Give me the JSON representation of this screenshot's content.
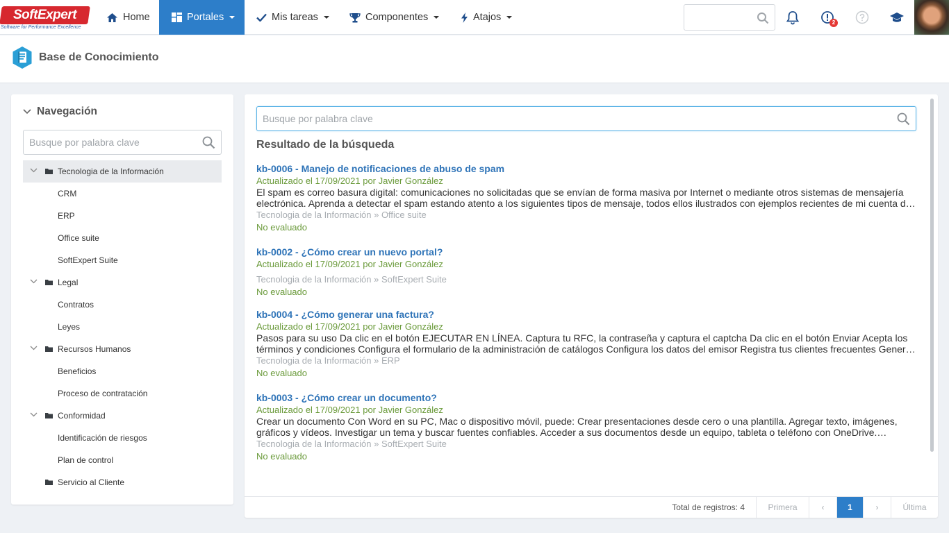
{
  "brand": {
    "name_left": "Soft",
    "name_right": "Expert",
    "tagline": "Software for Performance Excellence"
  },
  "nav": {
    "home": "Home",
    "portales": "Portales",
    "tareas": "Mis tareas",
    "componentes": "Componentes",
    "atajos": "Atajos"
  },
  "notifications": {
    "badge": "2"
  },
  "page": {
    "title": "Base de Conocimiento"
  },
  "sidebar": {
    "heading": "Navegación",
    "search_placeholder": "Busque por palabra clave",
    "tree": [
      {
        "label": "Tecnologia de la Información",
        "children": [
          "CRM",
          "ERP",
          "Office suite",
          "SoftExpert Suite"
        ]
      },
      {
        "label": "Legal",
        "children": [
          "Contratos",
          "Leyes"
        ]
      },
      {
        "label": "Recursos Humanos",
        "children": [
          "Beneficios",
          "Proceso de contratación"
        ]
      },
      {
        "label": "Conformidad",
        "children": [
          "Identificación de riesgos",
          "Plan de control"
        ]
      },
      {
        "label": "Servicio al Cliente",
        "children": []
      }
    ]
  },
  "main": {
    "search_placeholder": "Busque por palabra clave",
    "results_title": "Resultado de la búsqueda",
    "results": [
      {
        "title": "kb-0006 - Manejo de notificaciones de abuso de spam",
        "updated": "Actualizado el 17/09/2021 por Javier González",
        "description": "El spam es correo basura digital: comunicaciones no solicitadas que se envían de forma masiva por Internet o mediante otros sistemas de mensajería electrónica. Aprenda a detectar el spam estando atento a los siguientes tipos de mensaje, todos ellos ilustrados con ejemplos recientes de mi cuenta de correo.",
        "path": "Tecnologia de la Información » Office suite",
        "rating": "No evaluado"
      },
      {
        "title": "kb-0002 - ¿Cómo crear un nuevo portal?",
        "updated": "Actualizado el 17/09/2021 por Javier González",
        "description": "",
        "path": "Tecnologia de la Información » SoftExpert Suite",
        "rating": "No evaluado"
      },
      {
        "title": "kb-0004 - ¿Cómo generar una factura?",
        "updated": "Actualizado el 17/09/2021 por Javier González",
        "description": "Pasos para su uso Da clic en el botón EJECUTAR EN LÍNEA. Captura tu RFC, la contraseña y captura el captcha Da clic en el botón Enviar Acepta los términos y condiciones Configura el formulario de la administración de catálogos Configura los datos del emisor Registra tus clientes frecuentes Genera y emite tus facturas.",
        "path": "Tecnologia de la Información » ERP",
        "rating": "No evaluado"
      },
      {
        "title": "kb-0003 - ¿Cómo crear un documento?",
        "updated": "Actualizado el 17/09/2021 por Javier González",
        "description": "Crear un documento Con Word en su PC, Mac o dispositivo móvil, puede: Crear presentaciones desde cero o una plantilla. Agregar texto, imágenes, gráficos y vídeos. Investigar un tema y buscar fuentes confiables. Acceder a sus documentos desde un equipo, tableta o teléfono con OneDrive. Compartir y colaborar.",
        "path": "Tecnologia de la Información » SoftExpert Suite",
        "rating": "No evaluado"
      }
    ]
  },
  "pagination": {
    "total": "Total de registros: 4",
    "first": "Primera",
    "prev": "‹",
    "current": "1",
    "next": "›",
    "last": "Última"
  },
  "colors": {
    "accent": "#2d7ec9",
    "link": "#2f74b8",
    "meta_green": "#6a9a3a",
    "brand_red": "#d7282f"
  }
}
